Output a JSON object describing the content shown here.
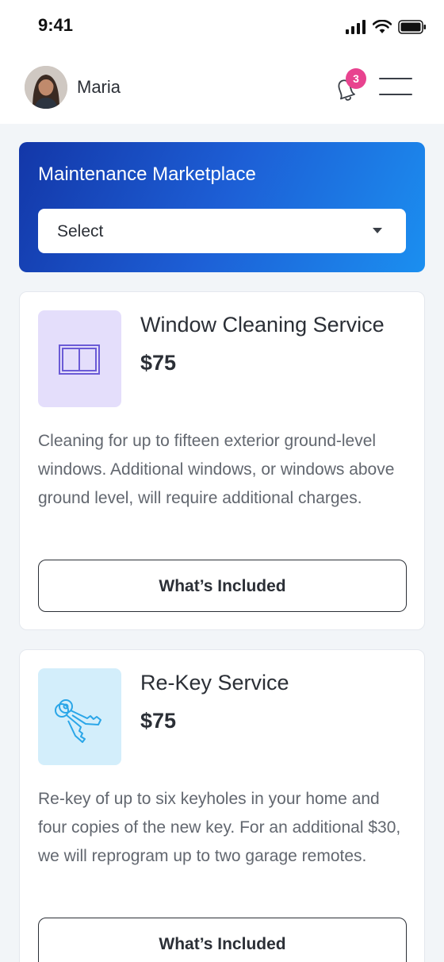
{
  "status_bar": {
    "time": "9:41",
    "icons": [
      "signal-icon",
      "wifi-icon",
      "battery-icon"
    ]
  },
  "header": {
    "user_name": "Maria",
    "notification_count": "3",
    "icons": [
      "bell-icon",
      "hamburger-menu-icon"
    ]
  },
  "hero": {
    "title": "Maintenance Marketplace",
    "select_value": "Select"
  },
  "services": [
    {
      "title": "Window Cleaning Service",
      "price": "$75",
      "description": "Cleaning for up to fifteen exterior ground-level windows. Additional windows, or windows above ground level, will require additional charges.",
      "button_label": "What’s Included",
      "icon": "window-icon"
    },
    {
      "title": "Re-Key Service",
      "price": "$75",
      "description": "Re-key of up to six keyholes in your home and four copies of the new key. For an additional $30, we will reprogram up to two garage remotes.",
      "button_label": "What’s Included",
      "icon": "key-icon"
    }
  ],
  "colors": {
    "hero_gradient_start": "#1337a8",
    "hero_gradient_end": "#1b8ff0",
    "badge": "#e8438f",
    "window_thumb_bg": "#e4defb",
    "window_icon": "#6b5bd6",
    "key_thumb_bg": "#d3eefb",
    "key_icon": "#2aa6e8"
  }
}
